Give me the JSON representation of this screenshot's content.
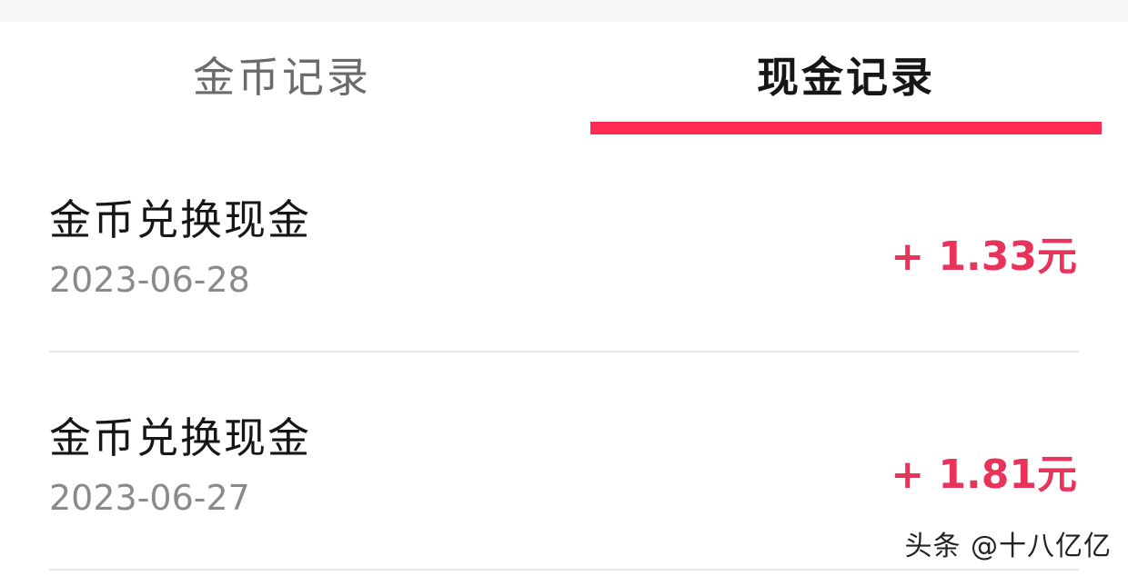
{
  "tabs": [
    {
      "label": "金币记录",
      "active": false
    },
    {
      "label": "现金记录",
      "active": true
    }
  ],
  "accent_color": "#fe2c55",
  "amount_color": "#e8335a",
  "records": [
    {
      "title": "金币兑换现金",
      "date": "2023-06-28",
      "amount": "+ 1.33元"
    },
    {
      "title": "金币兑换现金",
      "date": "2023-06-27",
      "amount": "+ 1.81元"
    }
  ],
  "watermark": "头条 @十八亿亿"
}
